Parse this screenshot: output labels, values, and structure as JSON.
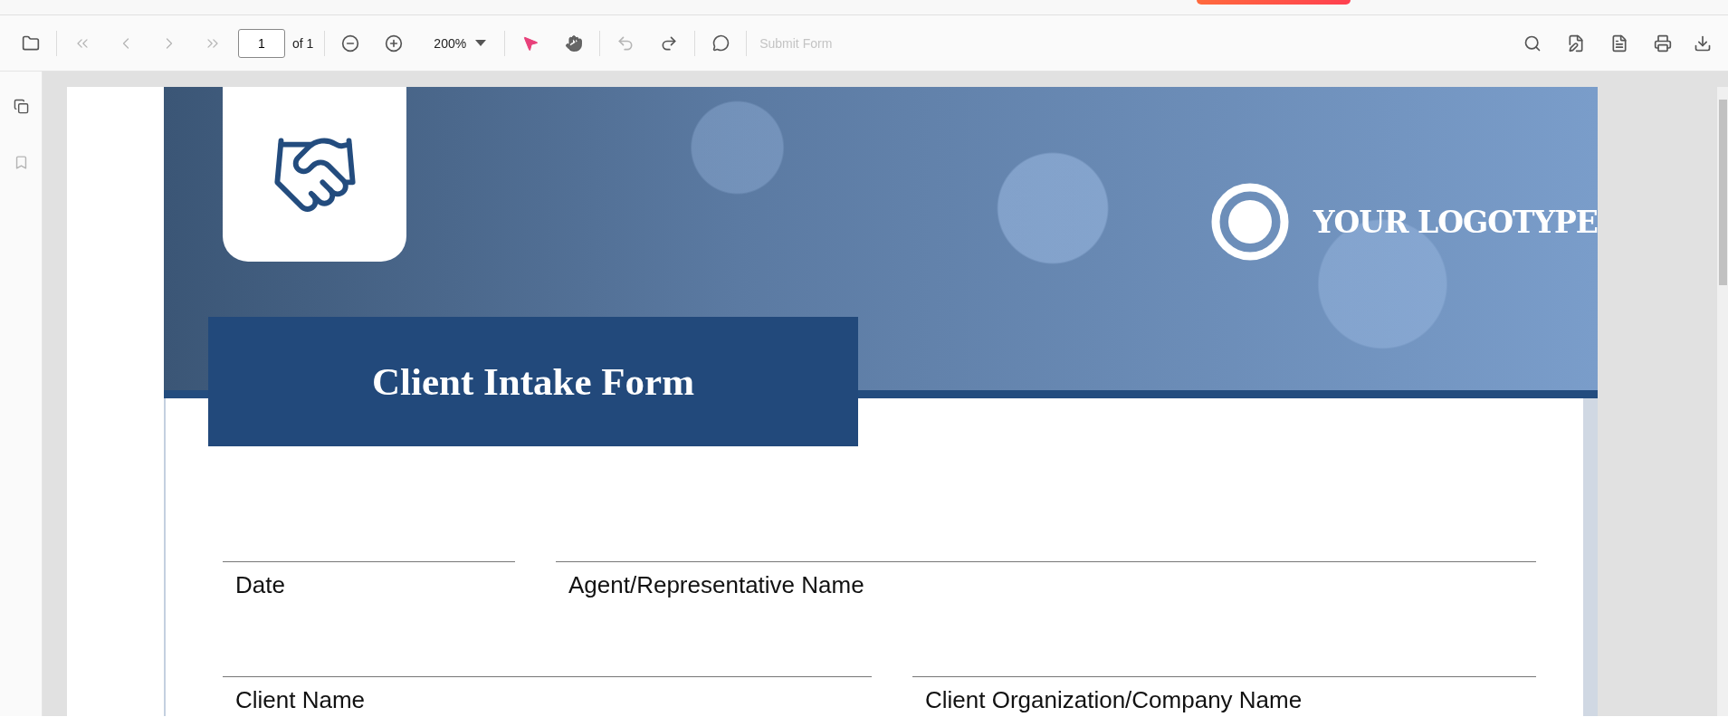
{
  "toolbar": {
    "nav_buttons": [
      {
        "disabled": true
      },
      {
        "disabled": true
      },
      {
        "disabled": true
      },
      {
        "disabled": true
      }
    ],
    "page_field": {
      "value": "1"
    },
    "page_count": "of 1",
    "zoom": "200%",
    "tools": [
      {
        "selected": true
      },
      {
        "selected": false
      }
    ],
    "undo": {
      "disabled": true
    },
    "redo": {
      "disabled": false
    },
    "submit": {
      "label": "Submit Form",
      "disabled": true
    }
  },
  "document": {
    "logotype": "YOUR LOGOTYPE",
    "title": "Client Intake Form",
    "rows": [
      [
        {
          "label": "Date"
        },
        {
          "label": "Agent/Representative Name"
        }
      ],
      [
        {
          "label": "Client Name"
        },
        {
          "label": "Client Organization/Company Name"
        }
      ]
    ]
  }
}
